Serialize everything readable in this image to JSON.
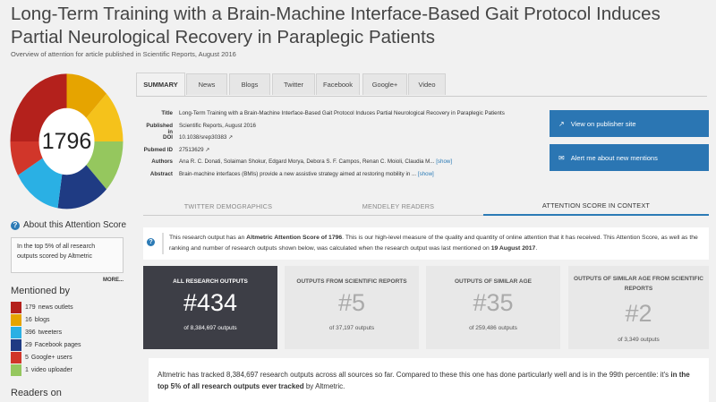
{
  "page": {
    "title": "Long-Term Training with a Brain-Machine Interface-Based Gait Protocol Induces Partial Neurological Recovery in Paraplegic Patients",
    "subtitle": "Overview of attention for article published in Scientific Reports, August 2016"
  },
  "sidebar": {
    "score": "1796",
    "about_label": "About this Attention Score",
    "top_text": "In the top 5% of all research outputs scored by Altmetric",
    "more_label": "MORE...",
    "mentioned_heading": "Mentioned by",
    "mentions": [
      {
        "count": "179",
        "label": "news outlets",
        "color": "#b4211c"
      },
      {
        "count": "16",
        "label": "blogs",
        "color": "#e6a400"
      },
      {
        "count": "396",
        "label": "tweeters",
        "color": "#2ab0e4"
      },
      {
        "count": "29",
        "label": "Facebook pages",
        "color": "#1f3b83"
      },
      {
        "count": "5",
        "label": "Google+ users",
        "color": "#d1362a"
      },
      {
        "count": "1",
        "label": "video uploader",
        "color": "#95c75e"
      }
    ],
    "readers_heading": "Readers on"
  },
  "tabs": [
    "SUMMARY",
    "News",
    "Blogs",
    "Twitter",
    "Facebook",
    "Google+",
    "Video"
  ],
  "meta": {
    "title_label": "Title",
    "title_value": "Long-Term Training with a Brain-Machine Interface-Based Gait Protocol Induces Partial Neurological Recovery in Paraplegic Patients",
    "published_label": "Published in",
    "published_value": "Scientific Reports, August 2016",
    "doi_label": "DOI",
    "doi_value": "10.1038/srep30383",
    "pubmed_label": "Pubmed ID",
    "pubmed_value": "27513629",
    "authors_label": "Authors",
    "authors_value": "Ana R. C. Donati, Solaiman Shokur, Edgard Morya, Debora S. F. Campos, Renan C. Moioli, Claudia M...",
    "authors_show": "[show]",
    "abstract_label": "Abstract",
    "abstract_value": "Brain-machine interfaces (BMIs) provide a new assistive strategy aimed at restoring mobility in ...",
    "abstract_show": "[show]"
  },
  "actions": {
    "publisher": "View on publisher site",
    "alert": "Alert me about new mentions"
  },
  "subtabs": [
    "TWITTER DEMOGRAPHICS",
    "MENDELEY READERS",
    "ATTENTION SCORE IN CONTEXT"
  ],
  "context": {
    "text_a": "This research output has an ",
    "text_b": "Altmetric Attention Score of 1796",
    "text_c": ". This is our high-level measure of the quality and quantity of online attention that it has received. This Attention Score, as well as the ranking and number of research outputs shown below, was calculated when the research output was last mentioned on ",
    "text_d": "19 August 2017",
    "text_e": "."
  },
  "cards": [
    {
      "heading": "ALL RESEARCH OUTPUTS",
      "rank": "#434",
      "of": "of 8,384,697 outputs"
    },
    {
      "heading": "OUTPUTS FROM SCIENTIFIC REPORTS",
      "rank": "#5",
      "of": "of 37,197 outputs"
    },
    {
      "heading": "OUTPUTS OF SIMILAR AGE",
      "rank": "#35",
      "of": "of 259,486 outputs"
    },
    {
      "heading": "OUTPUTS OF SIMILAR AGE FROM SCIENTIFIC REPORTS",
      "rank": "#2",
      "of": "of 3,349 outputs"
    }
  ],
  "summary": {
    "text_a": "Altmetric has tracked 8,384,697 research outputs across all sources so far. Compared to these this one has done particularly well and is in the 99th percentile: it's ",
    "text_b": "in the top 5% of all research outputs ever tracked",
    "text_c": " by Altmetric."
  }
}
